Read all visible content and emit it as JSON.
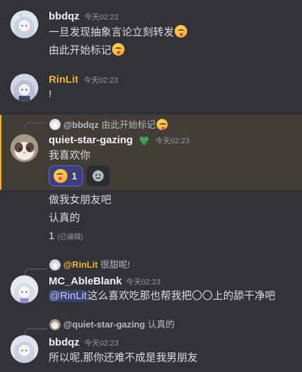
{
  "colors": {
    "background": "#313338",
    "highlight": "#423e37",
    "accent_bar": "#f0b232",
    "rinlit_name": "#f0b232",
    "mention_bg": "#3c4270"
  },
  "messages": [
    {
      "author": "bbdqz",
      "time": "今天02:22",
      "lines": [
        "一旦发现抽象言论立刻转发",
        "由此开始标记"
      ]
    },
    {
      "author": "RinLit",
      "time": "今天02:23",
      "lines": [
        "!"
      ]
    },
    {
      "reply": {
        "author": "@bbdqz",
        "text": "由此开始标记"
      },
      "author": "quiet-star-gazing",
      "badge_icon": "clover-icon",
      "time": "今天02:23",
      "lines": [
        "我喜欢你"
      ],
      "reaction": {
        "emoji": "yum-face",
        "count": "1"
      },
      "extra_lines": [
        "做我女朋友吧",
        "认真的"
      ],
      "edited_line": {
        "text": "1",
        "edited_label": "(已编辑)"
      }
    },
    {
      "reply": {
        "author": "@RinLit",
        "text": "很甜呢!"
      },
      "author": "MC_AbleBlank",
      "time": "今天02:23",
      "mention": "@RinLit",
      "text": "这么喜欢吃那也帮我把〇〇上的舔干净吧"
    },
    {
      "reply": {
        "author": "@quiet-star-gazing",
        "text": "认真的"
      },
      "author": "bbdqz",
      "time": "今天02:23",
      "lines": [
        "所以呢,那你还难不成是我男朋友"
      ]
    }
  ]
}
